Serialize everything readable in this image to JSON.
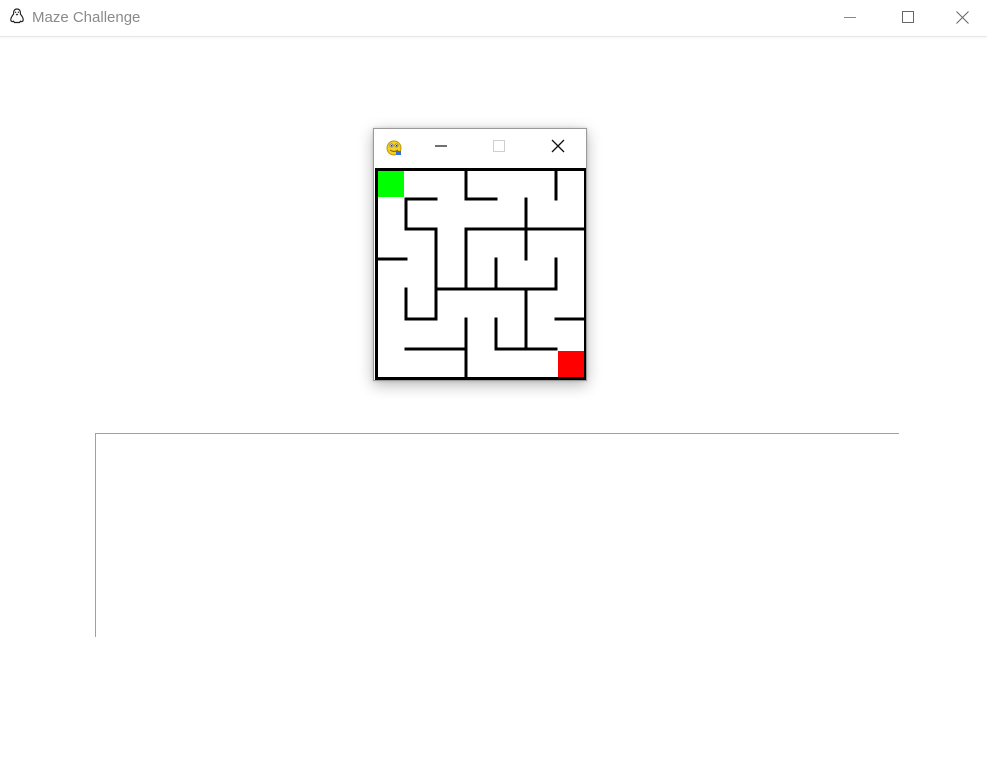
{
  "window": {
    "title": "Maze Challenge",
    "icon": "penguin-outline-icon",
    "controls": [
      "minimize-icon",
      "maximize-icon",
      "close-icon"
    ]
  },
  "game_window": {
    "icon": "pygame-snake-icon",
    "controls": [
      "minimize-icon",
      "maximize-icon-disabled",
      "close-icon"
    ]
  },
  "maze": {
    "rows": 7,
    "cols": 7,
    "start_cell": [
      0,
      0
    ],
    "goal_cell": [
      6,
      6
    ],
    "start_color": "#00ff00",
    "goal_color": "#ff0000",
    "wall_color": "#000000",
    "background_color": "#ffffff"
  },
  "text_panel": {
    "content": ""
  }
}
